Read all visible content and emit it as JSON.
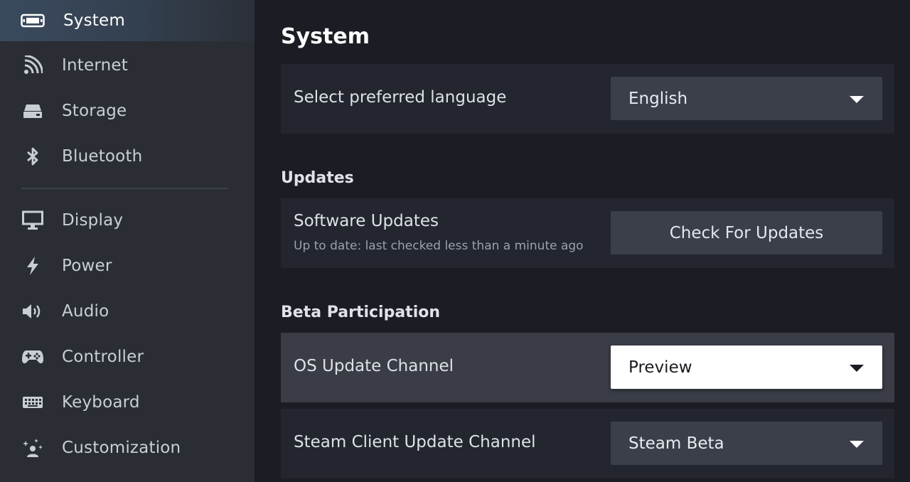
{
  "sidebar": {
    "items": [
      {
        "label": "System",
        "icon": "handheld-device-icon"
      },
      {
        "label": "Internet",
        "icon": "wifi-signal-icon"
      },
      {
        "label": "Storage",
        "icon": "storage-drive-icon"
      },
      {
        "label": "Bluetooth",
        "icon": "bluetooth-icon"
      },
      {
        "label": "Display",
        "icon": "monitor-icon"
      },
      {
        "label": "Power",
        "icon": "lightning-bolt-icon"
      },
      {
        "label": "Audio",
        "icon": "speaker-icon"
      },
      {
        "label": "Controller",
        "icon": "gamepad-icon"
      },
      {
        "label": "Keyboard",
        "icon": "keyboard-icon"
      },
      {
        "label": "Customization",
        "icon": "sparkle-person-icon"
      }
    ],
    "active_index": 0
  },
  "main": {
    "title": "System",
    "language": {
      "label": "Select preferred language",
      "value": "English"
    },
    "updates": {
      "section_title": "Updates",
      "label": "Software Updates",
      "status": "Up to date: last checked less than a minute ago",
      "button_label": "Check For Updates"
    },
    "beta": {
      "section_title": "Beta Participation",
      "os_channel": {
        "label": "OS Update Channel",
        "value": "Preview"
      },
      "client_channel": {
        "label": "Steam Client Update Channel",
        "value": "Steam Beta"
      }
    }
  },
  "colors": {
    "sidebar_bg": "#2a2d34",
    "main_bg": "#1b1d24",
    "row_bg": "#23262e",
    "row_highlight": "#3a3d46",
    "control_bg": "#3b3f49"
  }
}
